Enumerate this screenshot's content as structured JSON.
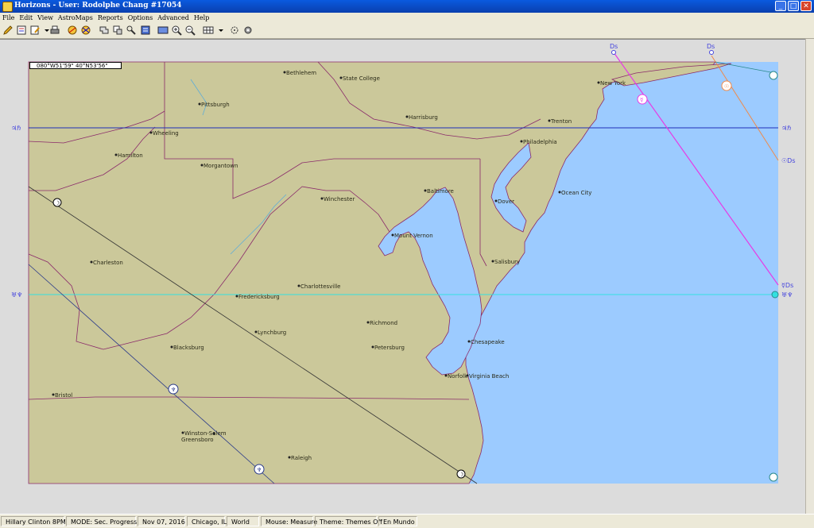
{
  "window": {
    "title": "Horizons - User: Rodolphe Chang #17054"
  },
  "menu": [
    "File",
    "Edit",
    "View",
    "AstroMaps",
    "Reports",
    "Options",
    "Advanced",
    "Help"
  ],
  "toolbar_icons": [
    "pencil-icon",
    "chart-icon",
    "edit-chart-icon",
    "dropdown-arrow-icon",
    "print-icon",
    "astromap-icon",
    "astromap-lines-icon",
    "locate-icon",
    "zoom-region-icon",
    "relocate-icon",
    "report-icon",
    "map-view-icon",
    "zoom-in-icon",
    "zoom-out-icon",
    "grid-icon",
    "dropdown-arrow-icon",
    "center-icon",
    "settings-icon"
  ],
  "coords": "080°W51'59\"  40°N53'56\"",
  "cities": [
    {
      "name": "Bethlehem"
    },
    {
      "name": "State College"
    },
    {
      "name": "Pittsburgh"
    },
    {
      "name": "Harrisburg"
    },
    {
      "name": "New York"
    },
    {
      "name": "Trenton"
    },
    {
      "name": "Wheeling"
    },
    {
      "name": "Philadelphia"
    },
    {
      "name": "Hamilton"
    },
    {
      "name": "Morgantown"
    },
    {
      "name": "Baltimore"
    },
    {
      "name": "Ocean City"
    },
    {
      "name": "Winchester"
    },
    {
      "name": "Dover"
    },
    {
      "name": "Mount Vernon"
    },
    {
      "name": "Charleston"
    },
    {
      "name": "Salisbury"
    },
    {
      "name": "Charlottesville"
    },
    {
      "name": "Fredericksburg"
    },
    {
      "name": "Richmond"
    },
    {
      "name": "Lynchburg"
    },
    {
      "name": "Chesapeake"
    },
    {
      "name": "Blacksburg"
    },
    {
      "name": "Petersburg"
    },
    {
      "name": "Norfolk"
    },
    {
      "name": "Virginia Beach"
    },
    {
      "name": "Bristol"
    },
    {
      "name": "Winston-Salem"
    },
    {
      "name": "Greensboro"
    },
    {
      "name": "Raleigh"
    }
  ],
  "line_labels": {
    "jupiter_left": "♃ℏ",
    "jupiter_right": "♃ℏ",
    "uranus_left": "♅♆",
    "uranus_right": "☿Ds",
    "uranus_right2": "♅♆",
    "ds_top1": "Ds",
    "ds_top2": "Ds",
    "sun_ds_right": "☉Ds"
  },
  "colors": {
    "land": "#cbc89a",
    "water": "#9ccbff",
    "border": "#8a2a6a",
    "jupiter_line": "#1f2fb8",
    "uranus_line": "#33e0e0",
    "mercury_line": "#e63be6",
    "sun_line": "#f08a4a",
    "black_line": "#333333",
    "navy_line": "#2a3a8a"
  },
  "status": [
    "Hillary Clinton 8PM",
    "MODE: Sec. Progress",
    "Nov 07, 2016",
    "Chicago, IL",
    "World",
    "Mouse: Measure",
    "Theme: Themes Off",
    "En Mundo"
  ]
}
